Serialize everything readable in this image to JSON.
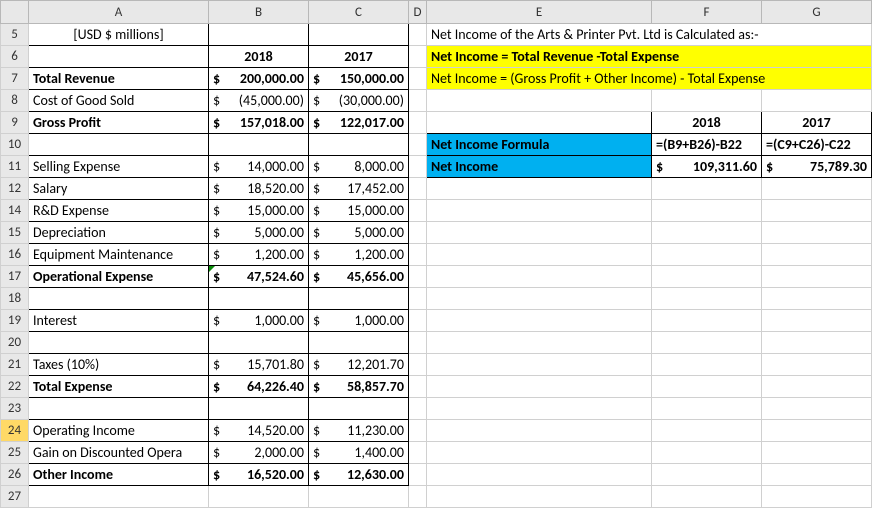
{
  "colHeaders": {
    "A": "A",
    "B": "B",
    "C": "C",
    "D": "D",
    "E": "E",
    "F": "F",
    "G": "G"
  },
  "rowNums": {
    "5": "5",
    "6": "6",
    "7": "7",
    "8": "8",
    "9": "9",
    "10": "10",
    "11": "11",
    "12": "12",
    "14": "14",
    "15": "15",
    "16": "16",
    "17": "17",
    "18": "18",
    "19": "19",
    "20": "20",
    "21": "21",
    "22": "22",
    "23": "23",
    "24": "24",
    "25": "25",
    "26": "26",
    "27": "27"
  },
  "title": "[USD $ millions]",
  "years": {
    "y2018": "2018",
    "y2017": "2017"
  },
  "labels": {
    "total_revenue": "Total Revenue",
    "cogs": "Cost of Good Sold",
    "gross_profit": "Gross Profit",
    "selling": "Selling Expense",
    "salary": "Salary",
    "rnd": "R&D Expense",
    "depr": "Depreciation",
    "equip": "Equipment Maintenance",
    "opex": "Operational Expense",
    "interest": "Interest",
    "taxes": "Taxes (10%)",
    "total_exp": "Total Expense",
    "op_income": "Operating Income",
    "gain": "Gain on Discounted Opera",
    "other_inc": "Other Income"
  },
  "vals": {
    "total_revenue_18": "200,000.00",
    "total_revenue_17": "150,000.00",
    "cogs_18": "45,000.00",
    "cogs_17": "30,000.00",
    "gross_profit_18": "157,018.00",
    "gross_profit_17": "122,017.00",
    "selling_18": "14,000.00",
    "selling_17": "8,000.00",
    "salary_18": "18,520.00",
    "salary_17": "17,452.00",
    "rnd_18": "15,000.00",
    "rnd_17": "15,000.00",
    "depr_18": "5,000.00",
    "depr_17": "5,000.00",
    "equip_18": "1,200.00",
    "equip_17": "1,200.00",
    "opex_18": "47,524.60",
    "opex_17": "45,656.00",
    "interest_18": "1,000.00",
    "interest_17": "1,000.00",
    "taxes_18": "15,701.80",
    "taxes_17": "12,201.70",
    "total_exp_18": "64,226.40",
    "total_exp_17": "58,857.70",
    "op_income_18": "14,520.00",
    "op_income_17": "11,230.00",
    "gain_18": "2,000.00",
    "gain_17": "1,400.00",
    "other_inc_18": "16,520.00",
    "other_inc_17": "12,630.00"
  },
  "explain": {
    "line1": "Net Income of the Arts & Printer Pvt. Ltd is Calculated as:-",
    "line2": "Net Income = Total Revenue -Total Expense",
    "line3": "Net Income = (Gross Profit + Other Income) - Total Expense"
  },
  "result": {
    "hdr": "",
    "y2018": "2018",
    "y2017": "2017",
    "formula_label": "Net Income Formula",
    "formula_18": "=(B9+B26)-B22",
    "formula_17": "=(C9+C26)-C22",
    "ni_label": "Net Income",
    "ni_18": "109,311.60",
    "ni_17": "75,789.30"
  },
  "sym": "$"
}
